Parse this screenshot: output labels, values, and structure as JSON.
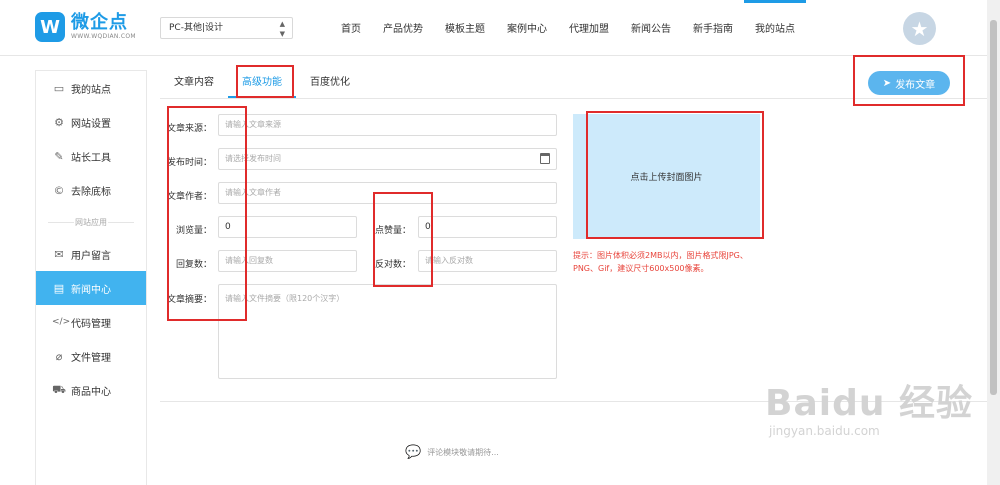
{
  "header": {
    "logo_mark": "W",
    "logo_name": "微企点",
    "logo_url": "WWW.WQDIAN.COM",
    "site_select": "PC-其他|设计",
    "nav": [
      "首页",
      "产品优势",
      "模板主题",
      "案例中心",
      "代理加盟",
      "新闻公告",
      "新手指南",
      "我的站点"
    ],
    "avatar_icon": "star-icon"
  },
  "sidebar": {
    "items_top": [
      {
        "label": "我的站点",
        "icon": "monitor-icon",
        "glyph": "▭"
      },
      {
        "label": "网站设置",
        "icon": "gear-icon",
        "glyph": "⚙"
      },
      {
        "label": "站长工具",
        "icon": "wrench-icon",
        "glyph": "✎"
      },
      {
        "label": "去除底标",
        "icon": "copyright-icon",
        "glyph": "©"
      }
    ],
    "divider": "网站应用",
    "items_bottom": [
      {
        "label": "用户留言",
        "icon": "message-icon",
        "glyph": "✉"
      },
      {
        "label": "新闻中心",
        "icon": "news-icon",
        "glyph": "▤"
      },
      {
        "label": "代码管理",
        "icon": "code-icon",
        "glyph": "</>"
      },
      {
        "label": "文件管理",
        "icon": "paperclip-icon",
        "glyph": "⌀"
      },
      {
        "label": "商品中心",
        "icon": "cart-icon",
        "glyph": "⛟"
      }
    ]
  },
  "tabs": [
    "文章内容",
    "高级功能",
    "百度优化"
  ],
  "active_tab": "高级功能",
  "publish_button": "发布文章",
  "form": {
    "source": {
      "label": "文章来源：",
      "placeholder": "请输入文章来源"
    },
    "publish_time": {
      "label": "发布时间：",
      "placeholder": "请选择发布时间"
    },
    "author": {
      "label": "文章作者：",
      "placeholder": "请输入文章作者"
    },
    "views": {
      "label": "浏览量：",
      "value": "0"
    },
    "likes": {
      "label": "点赞量：",
      "value": "0"
    },
    "replies": {
      "label": "回复数：",
      "placeholder": "请输入回复数"
    },
    "dislikes": {
      "label": "反对数：",
      "placeholder": "请输入反对数"
    },
    "summary": {
      "label": "文章摘要：",
      "placeholder": "请输入文件摘要（限120个汉字）"
    }
  },
  "upload": {
    "label": "点击上传封面图片",
    "tip": "提示：图片体积必须2MB以内，图片格式限JPG、PNG、Gif，建议尺寸600x500像素。"
  },
  "comment_note": "评论模块敬请期待...",
  "watermark": {
    "main": "Baidu 经验",
    "sub": "jingyan.baidu.com"
  },
  "colors": {
    "accent": "#1e9be6",
    "active_side": "#41b3ef",
    "annotation": "#e02b2b",
    "tip": "#e8453c"
  }
}
